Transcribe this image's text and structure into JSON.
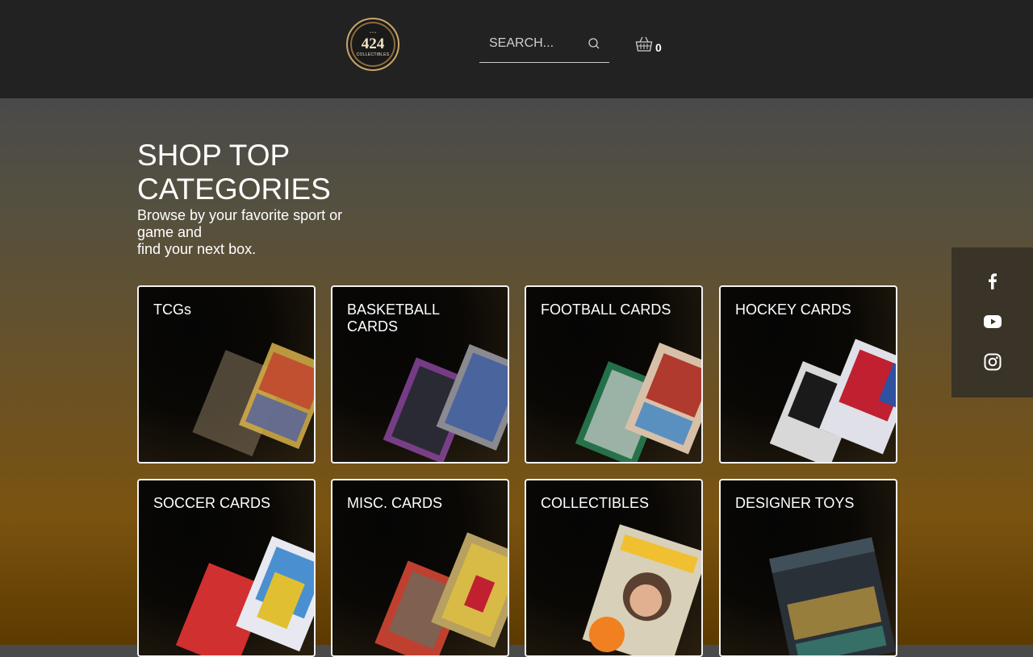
{
  "header": {
    "logo": {
      "number": "424",
      "subtitle": "COLLECTIBLES"
    },
    "search": {
      "placeholder": "SEARCH..."
    },
    "cart": {
      "count": "0"
    }
  },
  "main": {
    "title": "SHOP TOP\nCATEGORIES",
    "subtitle": "Browse by your favorite sport or game and\nfind your next box."
  },
  "categories": [
    {
      "label": "TCGs",
      "accent": "#d8b24a"
    },
    {
      "label": "BASKETBALL CARDS",
      "accent": "#9a4fb0"
    },
    {
      "label": "FOOTBALL CARDS",
      "accent": "#b03a2e"
    },
    {
      "label": "HOCKEY CARDS",
      "accent": "#c02030"
    },
    {
      "label": "SOCCER CARDS",
      "accent": "#e0c030"
    },
    {
      "label": "MISC. CARDS",
      "accent": "#c8a040"
    },
    {
      "label": "COLLECTIBLES",
      "accent": "#d0c8b0"
    },
    {
      "label": "DESIGNER TOYS",
      "accent": "#405060"
    }
  ],
  "social": [
    {
      "name": "facebook-icon"
    },
    {
      "name": "youtube-icon"
    },
    {
      "name": "instagram-icon"
    }
  ]
}
